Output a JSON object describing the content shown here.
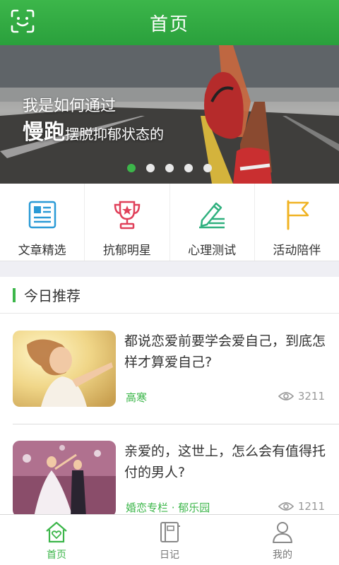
{
  "header": {
    "title": "首页",
    "scan_icon": "face-scan-icon"
  },
  "banner": {
    "line1": "我是如何通过",
    "line2_big": "慢跑",
    "line2_rest": "摆脱抑郁状态的",
    "dots_total": 5,
    "active_dot": 1
  },
  "menu": [
    {
      "label": "文章精选",
      "icon": "article-icon",
      "color": "#2a9ad6"
    },
    {
      "label": "抗郁明星",
      "icon": "trophy-icon",
      "color": "#e0405a"
    },
    {
      "label": "心理测试",
      "icon": "pencil-test-icon",
      "color": "#2fb07e"
    },
    {
      "label": "活动陪伴",
      "icon": "flag-icon",
      "color": "#f0b323"
    }
  ],
  "recommend": {
    "title": "今日推荐",
    "articles": [
      {
        "title": "都说恋爱前要学会爱自己，到底怎样才算爱自己?",
        "source": "高寒",
        "views": "3211"
      },
      {
        "title": "亲爱的，这世上，怎么会有值得托付的男人?",
        "source": "婚恋专栏 · 郁乐园",
        "views": "1211"
      }
    ]
  },
  "tabs": [
    {
      "label": "首页",
      "icon": "home-heart-icon",
      "active": true
    },
    {
      "label": "日记",
      "icon": "diary-icon",
      "active": false
    },
    {
      "label": "我的",
      "icon": "profile-icon",
      "active": false
    }
  ],
  "colors": {
    "accent": "#3cb64a",
    "text": "#333333",
    "muted": "#999999"
  }
}
